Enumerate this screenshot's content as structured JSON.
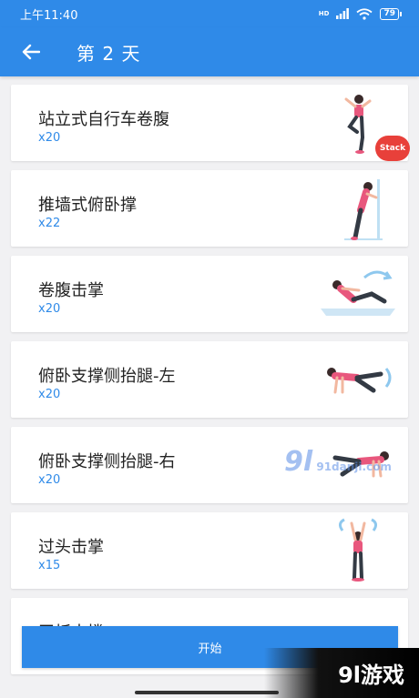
{
  "status_bar": {
    "time": "上午11:40",
    "network_label": "HD",
    "battery": "79"
  },
  "header": {
    "title": "第 2 天"
  },
  "exercises": [
    {
      "name": "站立式自行车卷腹",
      "count": "x20",
      "badge": "Stack"
    },
    {
      "name": "推墙式俯卧撑",
      "count": "x22"
    },
    {
      "name": "卷腹击掌",
      "count": "x20"
    },
    {
      "name": "俯卧支撑侧抬腿-左",
      "count": "x20"
    },
    {
      "name": "俯卧支撑侧抬腿-右",
      "count": "x20"
    },
    {
      "name": "过头击掌",
      "count": "x15"
    },
    {
      "name": "平板支撑",
      "count": ""
    }
  ],
  "footer": {
    "start_label": "开始"
  },
  "watermark": {
    "corner_text": "9l游戏",
    "center_big": "9l",
    "center_small": "91danji.com"
  },
  "colors": {
    "primary": "#2f8ae8",
    "badge": "#e8403a",
    "skin": "#f2b8a0",
    "outfit_pink": "#e8577d",
    "outfit_dark": "#333a44"
  }
}
